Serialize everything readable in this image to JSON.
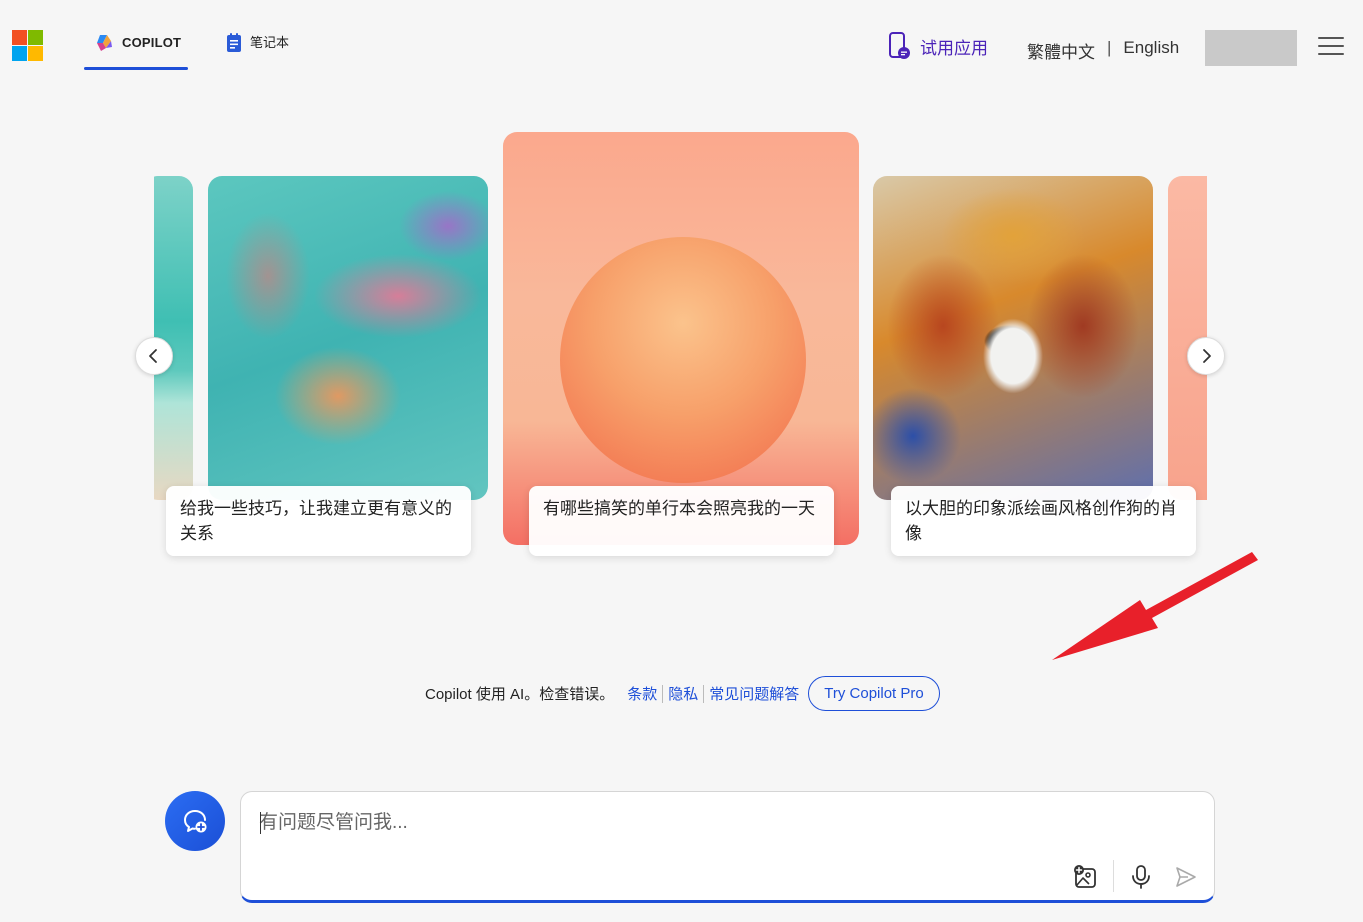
{
  "header": {
    "tabs": [
      {
        "label": "COPILOT",
        "active": true
      },
      {
        "label": "笔记本",
        "active": false
      }
    ],
    "try_app_label": "试用应用",
    "lang_traditional": "繁體中文",
    "lang_separator": "|",
    "lang_english": "English"
  },
  "carousel": {
    "cards": [
      {
        "caption": "给我一些技巧，让我建立更有意义的关系",
        "icon": "holding-hands-painting"
      },
      {
        "caption": "有哪些搞笑的单行本会照亮我的一天",
        "icon": "sun-painting"
      },
      {
        "caption": "以大胆的印象派绘画风格创作狗的肖像",
        "icon": "dog-painting"
      }
    ]
  },
  "footer_info": {
    "text": "Copilot 使用 AI。检查错误。",
    "links": [
      "条款",
      "隐私",
      "常见问题解答"
    ],
    "pro_button": "Try Copilot Pro"
  },
  "chat": {
    "placeholder": "有问题尽管问我..."
  },
  "colors": {
    "accent": "#1e4fd8",
    "try_app": "#4b23b8",
    "background": "#f6f6f6",
    "annotation_arrow": "#e8202a"
  }
}
